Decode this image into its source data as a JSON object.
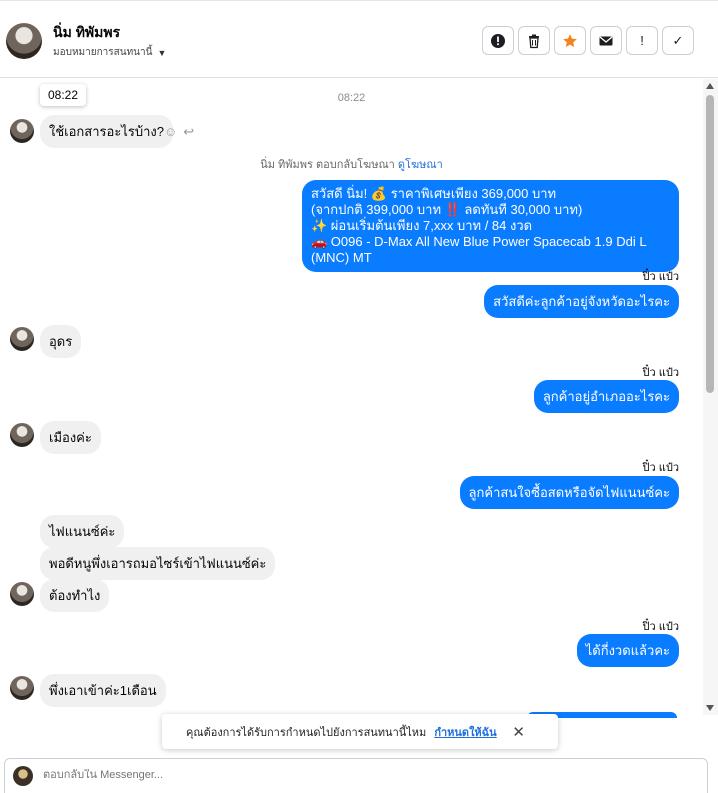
{
  "header": {
    "name": "นิ่ม ทิพัมพร",
    "subtitle": "มอบหมายการสนทนานี้",
    "toolbar": {
      "alert": "!",
      "important": "!",
      "done": "✓"
    }
  },
  "chat": {
    "tooltip_time": "08:22",
    "center_time": "08:22",
    "reply_note": {
      "text": "นิ่ม ทิพัมพร ตอบกลับโฆษณา",
      "link": "ดูโฆษณา"
    },
    "ad_message": {
      "line1": "สวัสดี นิ่ม! 💰 ราคาพิเศษเพียง 369,000 บาท",
      "line2": "(จากปกติ 399,000 บาท ‼️ ลดทันที 30,000 บาท)",
      "line3": "✨ ผ่อนเริ่มต้นเพียง 7,xxx บาท / 84 งวด",
      "line4": "🚗 O096 - D-Max All New Blue Power Spacecab 1.9 Ddi L (MNC) MT"
    },
    "messages": [
      {
        "dir": "in",
        "text": "ใช้เอกสารอะไรบ้าง?"
      },
      {
        "dir": "out",
        "sender": "ปิ๋ว แป๋ว",
        "text": "สวัสดีค่ะลูกค้าอยู่จังหวัดอะไรคะ"
      },
      {
        "dir": "in",
        "text": "อุดร"
      },
      {
        "dir": "out",
        "sender": "ปิ๋ว แป๋ว",
        "text": "ลูกค้าอยู่อำเภออะไรคะ"
      },
      {
        "dir": "in",
        "text": "เมืองค่ะ"
      },
      {
        "dir": "out",
        "sender": "ปิ๋ว แป๋ว",
        "text": "ลูกค้าสนใจซื้อสดหรือจัดไฟแนนซ์คะ"
      },
      {
        "dir": "in",
        "text": "ไฟแนนซ์ค่ะ"
      },
      {
        "dir": "in",
        "text": "พอดีหนูพึ่งเอารถมอไซร์เข้าไฟแนนซ์ค่ะ"
      },
      {
        "dir": "in",
        "text": "ต้องทำไง"
      },
      {
        "dir": "out",
        "sender": "ปิ๋ว แป๋ว",
        "text": "ได้กี่งวดแล้วคะ"
      },
      {
        "dir": "in",
        "text": "พึ่งเอาเข้าค่ะ1เดือน"
      }
    ]
  },
  "prompt": {
    "text": "คุณต้องการได้รับการกำหนดไปยังการสนทนานี้ไหม",
    "link": "กำหนดให้ฉัน",
    "close": "✕"
  },
  "composer": {
    "placeholder": "ตอบกลับใน Messenger..."
  },
  "colors": {
    "outgoing_bubble": "#0a7cff",
    "incoming_bubble": "#f0f0f0",
    "star": "#f5821f"
  }
}
